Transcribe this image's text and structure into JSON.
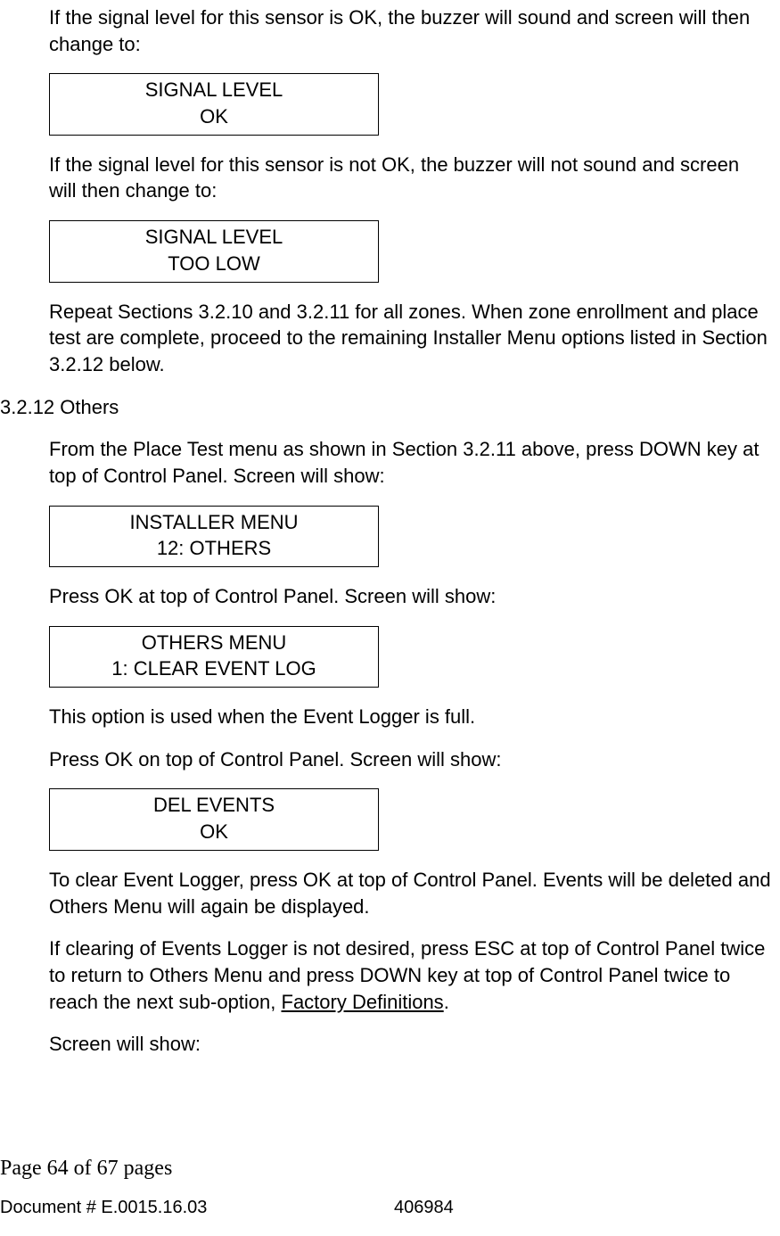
{
  "para1": "If the signal level for this sensor is OK, the buzzer will sound and screen will then change to:",
  "box1": {
    "l1": "SIGNAL LEVEL",
    "l2": "OK"
  },
  "para2": "If the signal level for this sensor is not OK, the buzzer will not sound and screen will then change to:",
  "box2": {
    "l1": "SIGNAL LEVEL",
    "l2": "TOO LOW"
  },
  "para3": "Repeat Sections 3.2.10 and 3.2.11 for all zones. When zone enrollment and place test are complete, proceed to the remaining Installer Menu options listed in Section 3.2.12 below.",
  "heading": "3.2.12 Others",
  "para4": "From the Place Test menu as shown in Section 3.2.11 above, press DOWN key at top of Control Panel. Screen will show:",
  "box3": {
    "l1": "INSTALLER MENU",
    "l2": "12: OTHERS"
  },
  "para5": "Press OK at top of Control Panel. Screen will show:",
  "box4": {
    "l1": "OTHERS MENU",
    "l2": "1: CLEAR EVENT LOG"
  },
  "para6": "This option is used when the Event Logger is full.",
  "para7": "Press OK on top of Control Panel. Screen will show:",
  "box5": {
    "l1": "DEL EVENTS",
    "l2": "OK"
  },
  "para8": "To clear Event Logger, press OK at top of Control Panel. Events will be deleted and Others Menu will again be displayed.",
  "para9a": "If clearing of Events Logger is not desired, press ESC at top of Control Panel twice to return to Others Menu and press DOWN key at top of Control Panel twice to reach the next sub-option, ",
  "para9b": "Factory Definitions",
  "para9c": ".",
  "para10": "Screen will show:",
  "footer_page": "Page 64 of  67 pages",
  "footer_doc": "Document # E.0015.16.03",
  "footer_num": "406984"
}
